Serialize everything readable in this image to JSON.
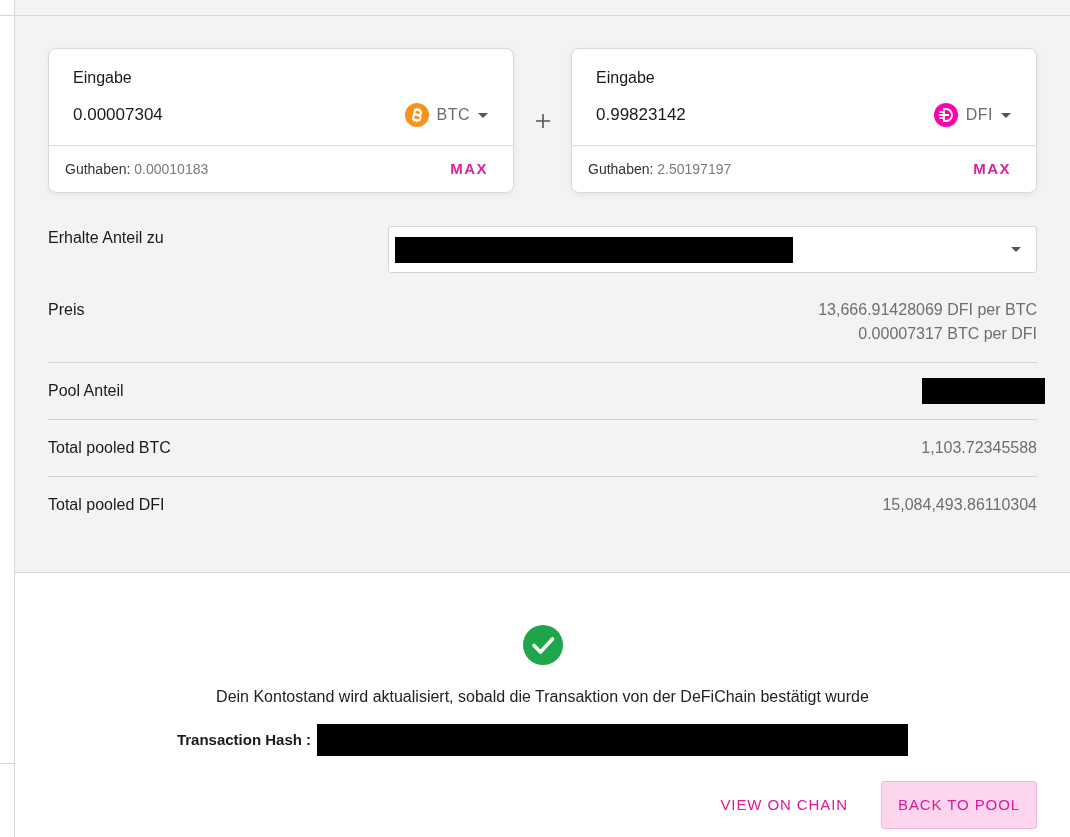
{
  "inputs": [
    {
      "label": "Eingabe",
      "value": "0.00007304",
      "token": "BTC",
      "kind": "btc",
      "balance_label": "Guthaben:",
      "balance": "0.00010183",
      "max_label": "MAX"
    },
    {
      "label": "Eingabe",
      "value": "0.99823142",
      "token": "DFI",
      "kind": "dfi",
      "balance_label": "Guthaben:",
      "balance": "2.50197197",
      "max_label": "MAX"
    }
  ],
  "receive": {
    "label": "Erhalte Anteil zu",
    "redacted": true
  },
  "details": [
    {
      "label": "Preis",
      "values": [
        "13,666.91428069 DFI per BTC",
        "0.00007317 BTC per DFI"
      ]
    },
    {
      "label": "Pool Anteil",
      "redacted": true
    },
    {
      "label": "Total pooled BTC",
      "values": [
        "1,103.72345588"
      ]
    },
    {
      "label": "Total pooled DFI",
      "values": [
        "15,084,493.86110304"
      ]
    }
  ],
  "confirmation": {
    "confirmed": true,
    "message": "Dein Kontostand wird aktualisiert, sobald die Transaktion von der DeFiChain bestätigt wurde",
    "hash_label": "Transaction Hash :",
    "hash_redacted": true
  },
  "buttons": [
    {
      "label": "VIEW ON CHAIN",
      "kind": "text"
    },
    {
      "label": "BACK TO POOL",
      "kind": "filled"
    }
  ]
}
